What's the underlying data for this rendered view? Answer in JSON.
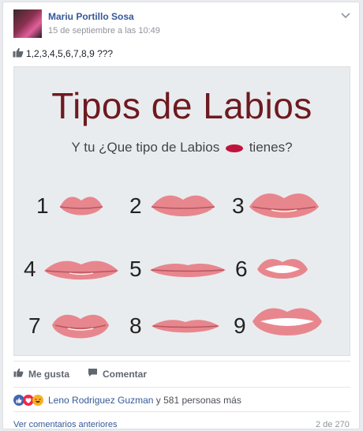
{
  "post": {
    "author": "Mariu Portillo Sosa",
    "date": "15 de septiembre a las 10:49",
    "text": "1,2,3,4,5,6,7,8,9 ???"
  },
  "image": {
    "title": "Tipos de Labios",
    "subtitle_before": "Y tu ¿Que tipo de Labios",
    "subtitle_after": "tienes?",
    "numbers": [
      "1",
      "2",
      "3",
      "4",
      "5",
      "6",
      "7",
      "8",
      "9"
    ]
  },
  "actions": {
    "like": "Me gusta",
    "comment": "Comentar"
  },
  "reactions": {
    "names": "Leno Rodriguez Guzman",
    "more": " y 581 personas más"
  },
  "footer": {
    "previous": "Ver comentarios anteriores",
    "count": "2 de 270"
  },
  "colors": {
    "link": "#365899",
    "muted": "#90949c",
    "like_blue": "#4267b2",
    "love_red": "#f0284a",
    "haha_yellow": "#f7b125",
    "lip": "#e8868e"
  },
  "icons": [
    "thumbs-up-icon",
    "chevron-down-icon",
    "comment-icon",
    "like-reaction-icon",
    "love-reaction-icon",
    "haha-reaction-icon"
  ]
}
